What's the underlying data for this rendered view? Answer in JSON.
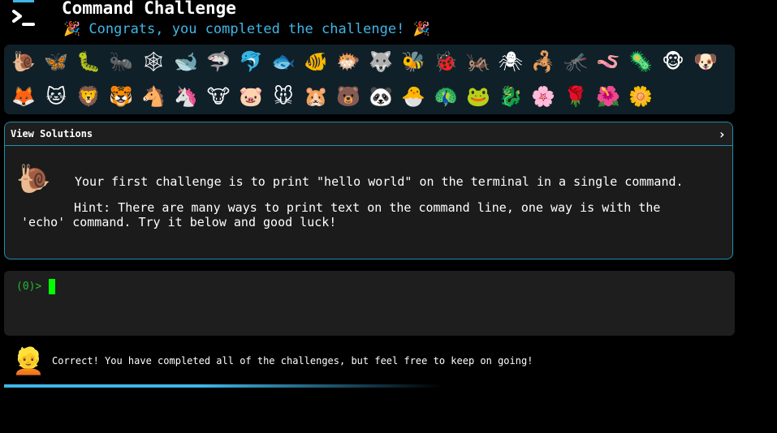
{
  "header": {
    "title": "Command Challenge",
    "congrats": "🎉 Congrats, you completed the challenge! 🎉"
  },
  "emojis": {
    "row1": [
      "🐌",
      "🦋",
      "🐛",
      "🐜",
      "🕸",
      "🐋",
      "🦈",
      "🐬",
      "🐟",
      "🐠",
      "🐡",
      "🐺",
      "🐝",
      "🐞",
      "🦗",
      "🕷",
      "🦂",
      "🦟",
      "🪱",
      "🦠",
      "🐵",
      "🐶"
    ],
    "row2": [
      "🦊",
      "🐱",
      "🦁",
      "🐯",
      "🐴",
      "🦄",
      "🐮",
      "🐷",
      "🐭",
      "🐹",
      "🐻",
      "🐼",
      "🐣",
      "🦚",
      "🐸",
      "🐉",
      "🌸",
      "🌹",
      "🌺",
      "🌼"
    ]
  },
  "challenge": {
    "view_solutions": "View Solutions",
    "chevron": "›",
    "icon": "🐌",
    "text": "Your first challenge is to print \"hello world\" on the terminal in a single command.",
    "hint": "Hint: There are many ways to print text on the command line, one way is with the 'echo' command. Try it below and good luck!"
  },
  "terminal": {
    "prompt": "(0)>"
  },
  "status": {
    "avatar": "👱",
    "message": "Correct! You have completed all of the challenges, but feel free to keep on going!"
  },
  "progress": {
    "fraction": 0.6,
    "color": "#3fb6e8"
  },
  "colors": {
    "accent": "#3fb6e8",
    "border": "#1f8fb0",
    "prompt": "#22bb33",
    "cursor": "#00ff00"
  }
}
